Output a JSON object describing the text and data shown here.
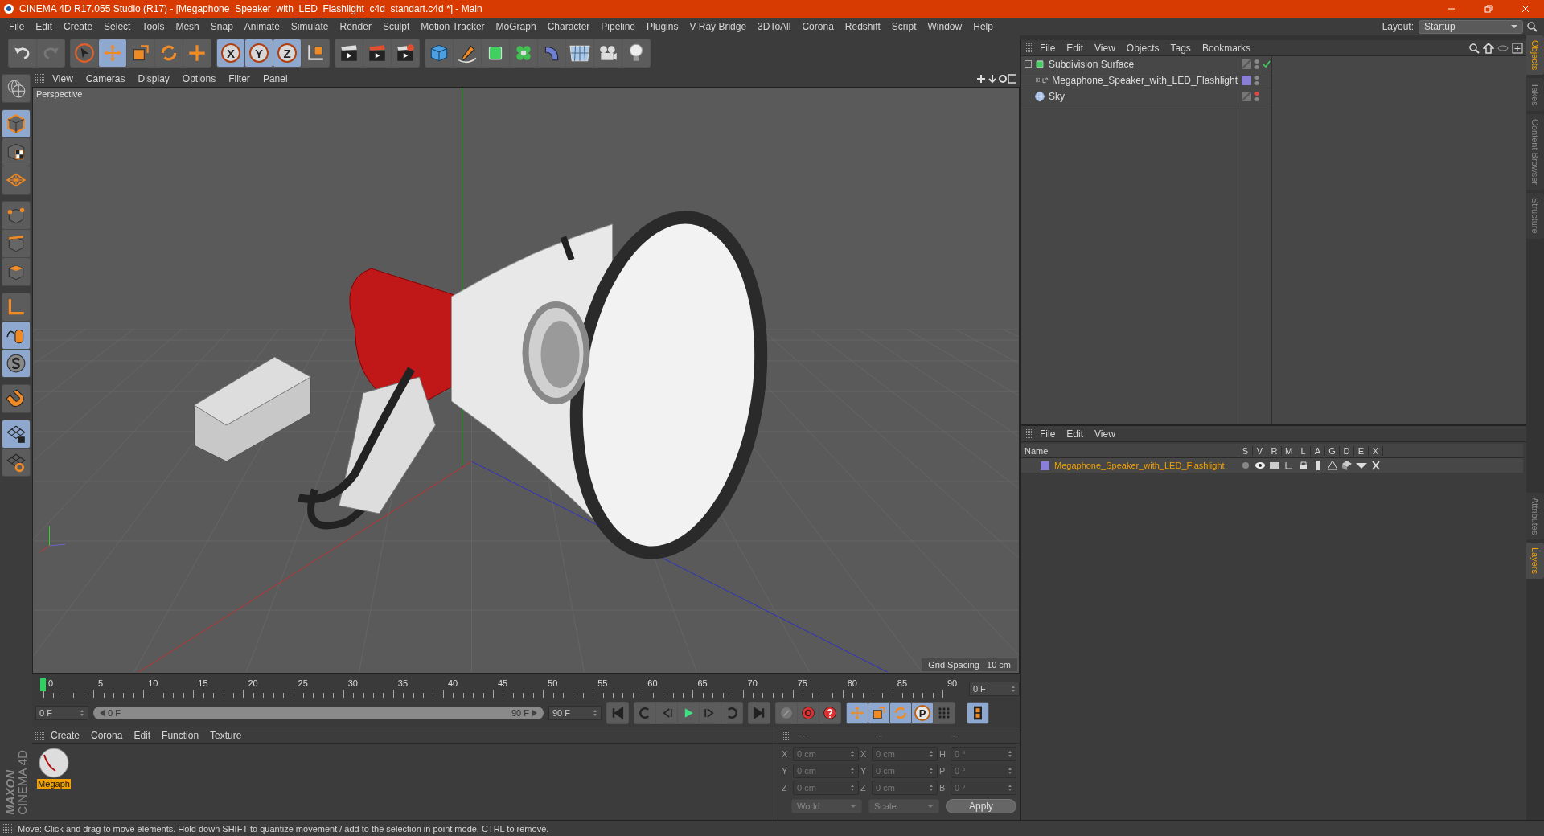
{
  "window": {
    "title": "CINEMA 4D R17.055 Studio (R17) - [Megaphone_Speaker_with_LED_Flashlight_c4d_standart.c4d *] - Main"
  },
  "menu": [
    "File",
    "Edit",
    "Create",
    "Select",
    "Tools",
    "Mesh",
    "Snap",
    "Animate",
    "Simulate",
    "Render",
    "Sculpt",
    "Motion Tracker",
    "MoGraph",
    "Character",
    "Pipeline",
    "Plugins",
    "V-Ray Bridge",
    "3DToAll",
    "Corona",
    "Redshift",
    "Script",
    "Window",
    "Help"
  ],
  "layout": {
    "label": "Layout:",
    "value": "Startup"
  },
  "toolbar": [
    {
      "items": [
        {
          "kind": "undo",
          "selected": false
        },
        {
          "kind": "redo",
          "selected": false
        }
      ]
    },
    {
      "items": [
        {
          "kind": "select",
          "selected": false
        },
        {
          "kind": "move",
          "selected": true
        },
        {
          "kind": "scale",
          "selected": false
        },
        {
          "kind": "rotate",
          "selected": false
        },
        {
          "kind": "transform",
          "selected": false
        }
      ]
    },
    {
      "items": [
        {
          "kind": "axis",
          "label": "X",
          "selected": true
        },
        {
          "kind": "axis",
          "label": "Y",
          "selected": true
        },
        {
          "kind": "axis",
          "label": "Z",
          "selected": true
        },
        {
          "kind": "coords",
          "selected": false
        }
      ]
    },
    {
      "items": [
        {
          "kind": "render-view",
          "selected": false
        },
        {
          "kind": "render-picture",
          "selected": false
        },
        {
          "kind": "render-settings",
          "selected": false
        }
      ]
    },
    {
      "items": [
        {
          "kind": "cube",
          "selected": false
        },
        {
          "kind": "pen",
          "selected": false
        },
        {
          "kind": "subdivision",
          "selected": false
        },
        {
          "kind": "cloner",
          "selected": false
        },
        {
          "kind": "deformer",
          "selected": false
        },
        {
          "kind": "floor",
          "selected": false
        },
        {
          "kind": "camera",
          "selected": false
        },
        {
          "kind": "light",
          "selected": false
        }
      ]
    }
  ],
  "palette": [
    {
      "items": [
        {
          "kind": "globe",
          "selected": false
        }
      ]
    },
    {
      "items": [
        {
          "kind": "model",
          "selected": true
        },
        {
          "kind": "texture",
          "selected": false
        },
        {
          "kind": "workplane",
          "selected": false
        }
      ]
    },
    {
      "items": [
        {
          "kind": "points",
          "selected": false
        },
        {
          "kind": "edges",
          "selected": false
        },
        {
          "kind": "polygons",
          "selected": false
        }
      ]
    },
    {
      "items": [
        {
          "kind": "axis-mode",
          "selected": false
        },
        {
          "kind": "tweak",
          "selected": true
        },
        {
          "kind": "solo",
          "selected": true
        }
      ]
    },
    {
      "items": [
        {
          "kind": "magnet",
          "selected": false
        }
      ]
    },
    {
      "items": [
        {
          "kind": "lock-grid",
          "selected": true
        },
        {
          "kind": "planar-grid",
          "selected": false
        }
      ]
    }
  ],
  "brand": {
    "maker": "MAXON",
    "product": "CINEMA 4D"
  },
  "viewport": {
    "menu": [
      "View",
      "Cameras",
      "Display",
      "Options",
      "Filter",
      "Panel"
    ],
    "camera": "Perspective",
    "grid_spacing": "Grid Spacing : 10 cm"
  },
  "timeline": {
    "ticks": [
      "0",
      "5",
      "10",
      "15",
      "20",
      "25",
      "30",
      "35",
      "40",
      "45",
      "50",
      "55",
      "60",
      "65",
      "70",
      "75",
      "80",
      "85",
      "90"
    ],
    "level": 0,
    "current": "0 F"
  },
  "transport": {
    "start": "0 F",
    "range": {
      "start": "0 F",
      "end": "90 F",
      "level": 1
    },
    "end": "90 F",
    "groups": [
      {
        "items": [
          {
            "kind": "first",
            "selected": false
          }
        ]
      },
      {
        "items": [
          {
            "kind": "prev-key",
            "selected": false
          },
          {
            "kind": "prev-frame",
            "selected": false
          },
          {
            "kind": "play",
            "selected": false
          },
          {
            "kind": "next-frame",
            "selected": false
          },
          {
            "kind": "next-key",
            "selected": false
          }
        ]
      },
      {
        "items": [
          {
            "kind": "last",
            "selected": false
          }
        ]
      },
      {
        "items": [
          {
            "kind": "motion",
            "selected": false
          },
          {
            "kind": "record",
            "selected": false
          },
          {
            "kind": "help",
            "selected": false
          }
        ]
      },
      {
        "items": [
          {
            "kind": "move",
            "selected": true
          },
          {
            "kind": "scale",
            "selected": true
          },
          {
            "kind": "rotate",
            "selected": true
          },
          {
            "kind": "param",
            "label": "P",
            "selected": true
          },
          {
            "kind": "dots",
            "selected": false
          }
        ]
      },
      {
        "items": [
          {
            "kind": "film",
            "selected": true
          }
        ]
      }
    ]
  },
  "materials": {
    "menu": [
      "Create",
      "Corona",
      "Edit",
      "Function",
      "Texture"
    ],
    "items": [
      {
        "name": "Megaph",
        "selected": true
      }
    ]
  },
  "coordinates": {
    "headers": [
      "--",
      "--",
      "--"
    ],
    "rows": [
      {
        "axis": "X",
        "position": "0 cm",
        "size_axis": "X",
        "size": "0 cm",
        "angle_axis": "H",
        "angle": "0 °"
      },
      {
        "axis": "Y",
        "position": "0 cm",
        "size_axis": "Y",
        "size": "0 cm",
        "angle_axis": "P",
        "angle": "0 °"
      },
      {
        "axis": "Z",
        "position": "0 cm",
        "size_axis": "Z",
        "size": "0 cm",
        "angle_axis": "B",
        "angle": "0 °"
      }
    ],
    "space": "World",
    "mode": "Scale",
    "apply": "Apply"
  },
  "objects": {
    "menu": [
      "File",
      "Edit",
      "View",
      "Objects",
      "Tags",
      "Bookmarks"
    ],
    "tree": [
      {
        "name": "Subdivision Surface",
        "kind": "subdivision",
        "expanded": true,
        "editor_hidden": false,
        "enabled": true,
        "children": [
          {
            "name": "Megaphone_Speaker_with_LED_Flashlight",
            "kind": "null",
            "expanded": false,
            "color": "#8a7fd6",
            "editor_hidden": false
          }
        ]
      },
      {
        "name": "Sky",
        "kind": "sky",
        "editor_hidden": true
      }
    ]
  },
  "layers": {
    "menu": [
      "File",
      "Edit",
      "View"
    ],
    "columns": [
      "Name",
      "S",
      "V",
      "R",
      "M",
      "L",
      "A",
      "G",
      "D",
      "E",
      "X"
    ],
    "rows": [
      {
        "name": "Megaphone_Speaker_with_LED_Flashlight",
        "color": "#8a7fd6"
      }
    ]
  },
  "side_tabs": [
    {
      "label": "Objects",
      "selected": true
    },
    {
      "label": "Takes",
      "selected": false
    },
    {
      "label": "Content Browser",
      "selected": false
    },
    {
      "label": "Structure",
      "selected": false
    }
  ],
  "side_tabs_lower": [
    {
      "label": "Attributes",
      "selected": false
    },
    {
      "label": "Layers",
      "selected": true
    }
  ],
  "status": "Move: Click and drag to move elements. Hold down SHIFT to quantize movement / add to the selection in point mode, CTRL to remove."
}
